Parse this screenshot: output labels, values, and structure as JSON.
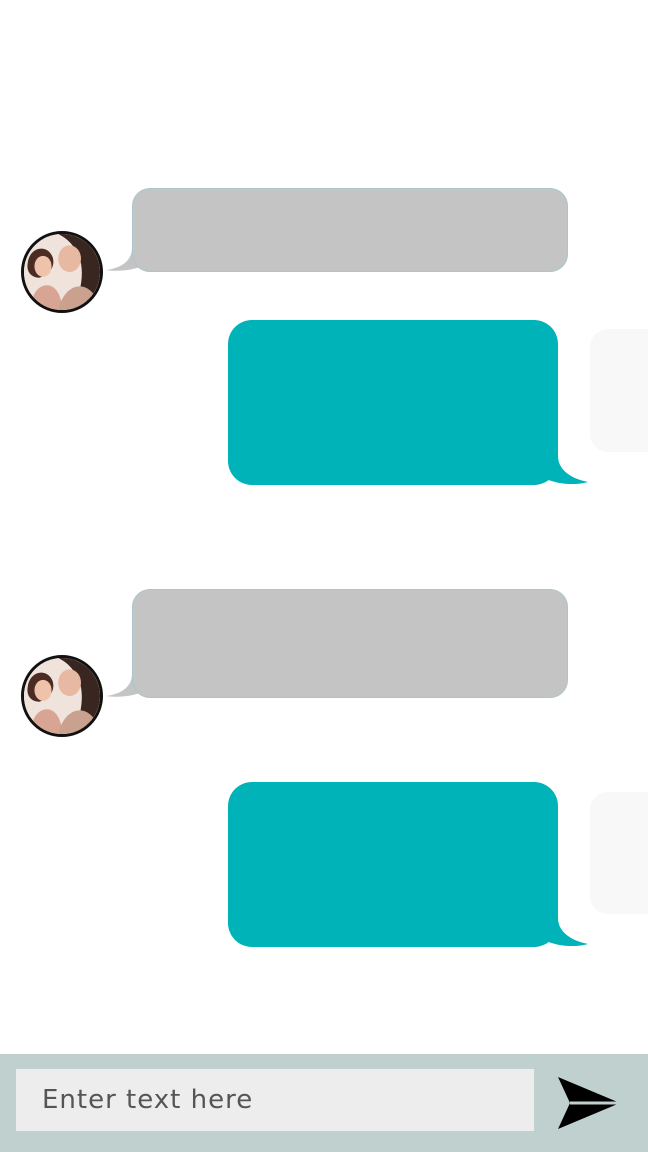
{
  "composer": {
    "placeholder": "Enter text here",
    "send_icon": "send-arrow-icon"
  },
  "messages": [
    {
      "direction": "incoming",
      "text": ""
    },
    {
      "direction": "outgoing",
      "text": ""
    },
    {
      "direction": "incoming",
      "text": ""
    },
    {
      "direction": "outgoing",
      "text": ""
    }
  ],
  "colors": {
    "incoming_bubble": "#c4c4c4",
    "outgoing_bubble": "#00b3b9",
    "composer_bar": "#c0d0cf",
    "input_background": "#ededed"
  }
}
